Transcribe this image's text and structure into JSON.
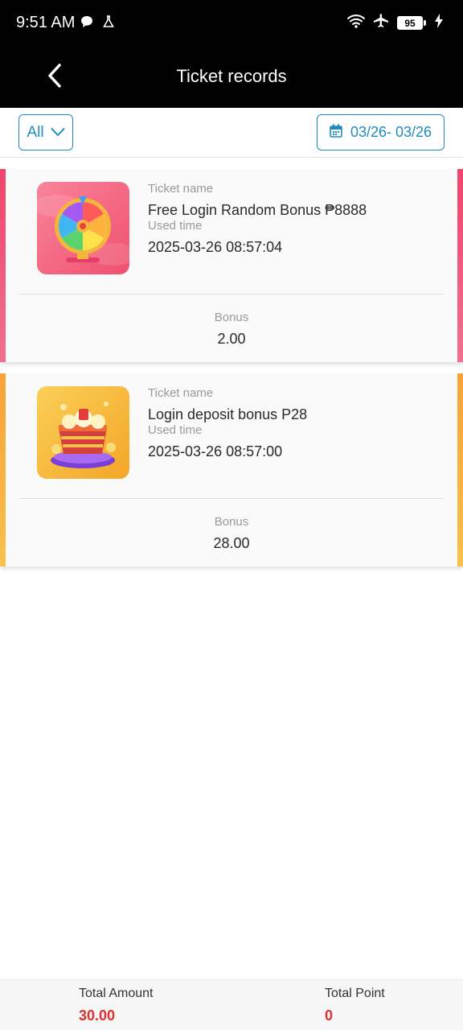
{
  "status_bar": {
    "time": "9:51 AM",
    "battery": "95",
    "icons": [
      "chat-bubble-icon",
      "flask-icon",
      "wifi-icon",
      "airplane-icon",
      "battery-icon",
      "charging-icon"
    ]
  },
  "header": {
    "title": "Ticket records",
    "back_icon": "chevron-left-icon"
  },
  "filters": {
    "type_value": "All",
    "date_range": "03/26- 03/26"
  },
  "records": [
    {
      "ticket_name_label": "Ticket name",
      "ticket_name": "Free Login Random Bonus ₱8888",
      "used_time_label": "Used time",
      "used_time": "2025-03-26 08:57:04",
      "bonus_label": "Bonus",
      "bonus": "2.00",
      "accent": "#f0456a",
      "thumb": "spin-wheel"
    },
    {
      "ticket_name_label": "Ticket name",
      "ticket_name": "Login deposit bonus P28",
      "used_time_label": "Used time",
      "used_time": "2025-03-26 08:57:00",
      "bonus_label": "Bonus",
      "bonus": "28.00",
      "accent": "#f7a23a",
      "thumb": "treasure-chest"
    }
  ],
  "footer": {
    "total_amount_label": "Total Amount",
    "total_amount": "30.00",
    "total_point_label": "Total Point",
    "total_point": "0"
  },
  "colors": {
    "accent_blue": "#1f8ac0",
    "total_red": "#e0302e"
  }
}
